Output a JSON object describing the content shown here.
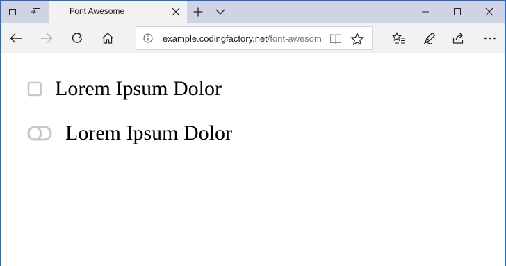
{
  "browser": {
    "tab": {
      "title": "Font Awesome"
    },
    "address": {
      "host": "example.codingfactory.net",
      "path": "/font-awesome"
    }
  },
  "content": {
    "items": [
      {
        "label": "Lorem Ipsum Dolor",
        "icon": "square-outline-icon"
      },
      {
        "label": "Lorem Ipsum Dolor",
        "icon": "toggle-off-icon"
      }
    ]
  },
  "colors": {
    "tabbar": "#cfd3e4",
    "toolbar": "#f2f2f2",
    "icon_gray": "#c8c8c8",
    "window_border": "#1e6ec9"
  }
}
